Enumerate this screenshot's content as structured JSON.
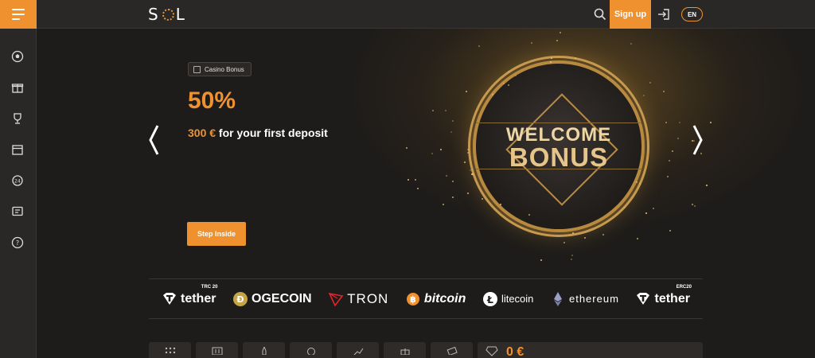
{
  "header": {
    "logo_text": "SOL",
    "signup_label": "Sign up",
    "lang_label": "EN"
  },
  "sidebar": {
    "items": [
      {
        "icon": "soccer-ball-icon"
      },
      {
        "icon": "gift-icon"
      },
      {
        "icon": "trophy-icon"
      },
      {
        "icon": "calendar-icon"
      },
      {
        "icon": "24h-support-icon"
      },
      {
        "icon": "chat-icon"
      },
      {
        "icon": "help-icon"
      }
    ]
  },
  "hero": {
    "badge_label": "Casino Bonus",
    "percent": "50%",
    "amount": "300 €",
    "deposit_text": " for your first deposit",
    "cta_label": "Step Inside",
    "coin_line1": "WELCOME",
    "coin_line2": "BONUS"
  },
  "crypto": [
    {
      "name": "tether",
      "sup": "TRC 20",
      "icon": "tether-icon"
    },
    {
      "name": "OGECOIN",
      "icon": "dogecoin-icon"
    },
    {
      "name": "TRON",
      "icon": "tron-icon"
    },
    {
      "name": "bitcoin",
      "icon": "bitcoin-icon"
    },
    {
      "name": "litecoin",
      "icon": "litecoin-icon"
    },
    {
      "name": "ethereum",
      "icon": "ethereum-icon"
    },
    {
      "name": "tether",
      "sup": "ERC20",
      "icon": "tether-icon"
    }
  ],
  "balance": {
    "value": "0 €"
  },
  "colors": {
    "accent": "#f0912f",
    "background": "#1e1c1a",
    "panel": "#2a2826"
  }
}
